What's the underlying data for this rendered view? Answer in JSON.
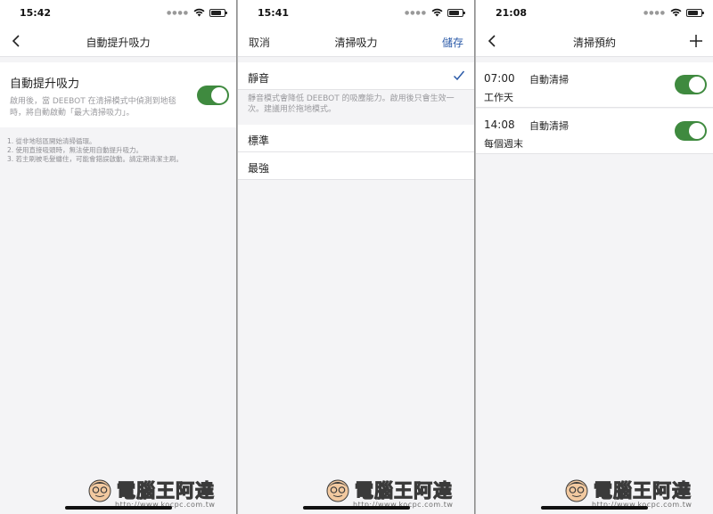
{
  "screens": [
    {
      "time": "15:42",
      "nav": {
        "title": "自動提升吸力"
      },
      "setting": {
        "title": "自動提升吸力",
        "description": "啟用後，當 DEEBOT 在清掃模式中偵測到地毯時，將自動啟動「最大清掃吸力」。",
        "enabled": true
      },
      "notes": [
        "1. 從非地毯區開始清掃循環。",
        "2. 使用直接吸頭時，無法使用自動提升吸力。",
        "3. 若主刷被毛髮纏住，可能會錯誤啟動。請定期清潔主刷。"
      ]
    },
    {
      "time": "15:41",
      "nav": {
        "left": "取消",
        "title": "清掃吸力",
        "right": "儲存"
      },
      "options": [
        {
          "label": "靜音",
          "selected": true
        },
        {
          "label": "標準",
          "selected": false
        },
        {
          "label": "最強",
          "selected": false
        }
      ],
      "hint": "靜音模式會降低 DEEBOT 的吸塵能力。啟用後只會生效一次。建議用於拖地模式。"
    },
    {
      "time": "21:08",
      "nav": {
        "title": "清掃預約"
      },
      "schedules": [
        {
          "time": "07:00",
          "mode": "自動清掃",
          "repeat": "工作天",
          "enabled": true
        },
        {
          "time": "14:08",
          "mode": "自動清掃",
          "repeat": "每個週末",
          "enabled": true
        }
      ]
    }
  ],
  "watermark": {
    "brand": "電腦王阿達",
    "url": "http://www.kocpc.com.tw"
  },
  "colors": {
    "toggle_on": "#3f8a3f",
    "accent_blue": "#2b5aa8"
  },
  "icons": [
    "back-icon",
    "plus-icon",
    "checkmark-icon",
    "wifi-icon",
    "battery-icon"
  ]
}
